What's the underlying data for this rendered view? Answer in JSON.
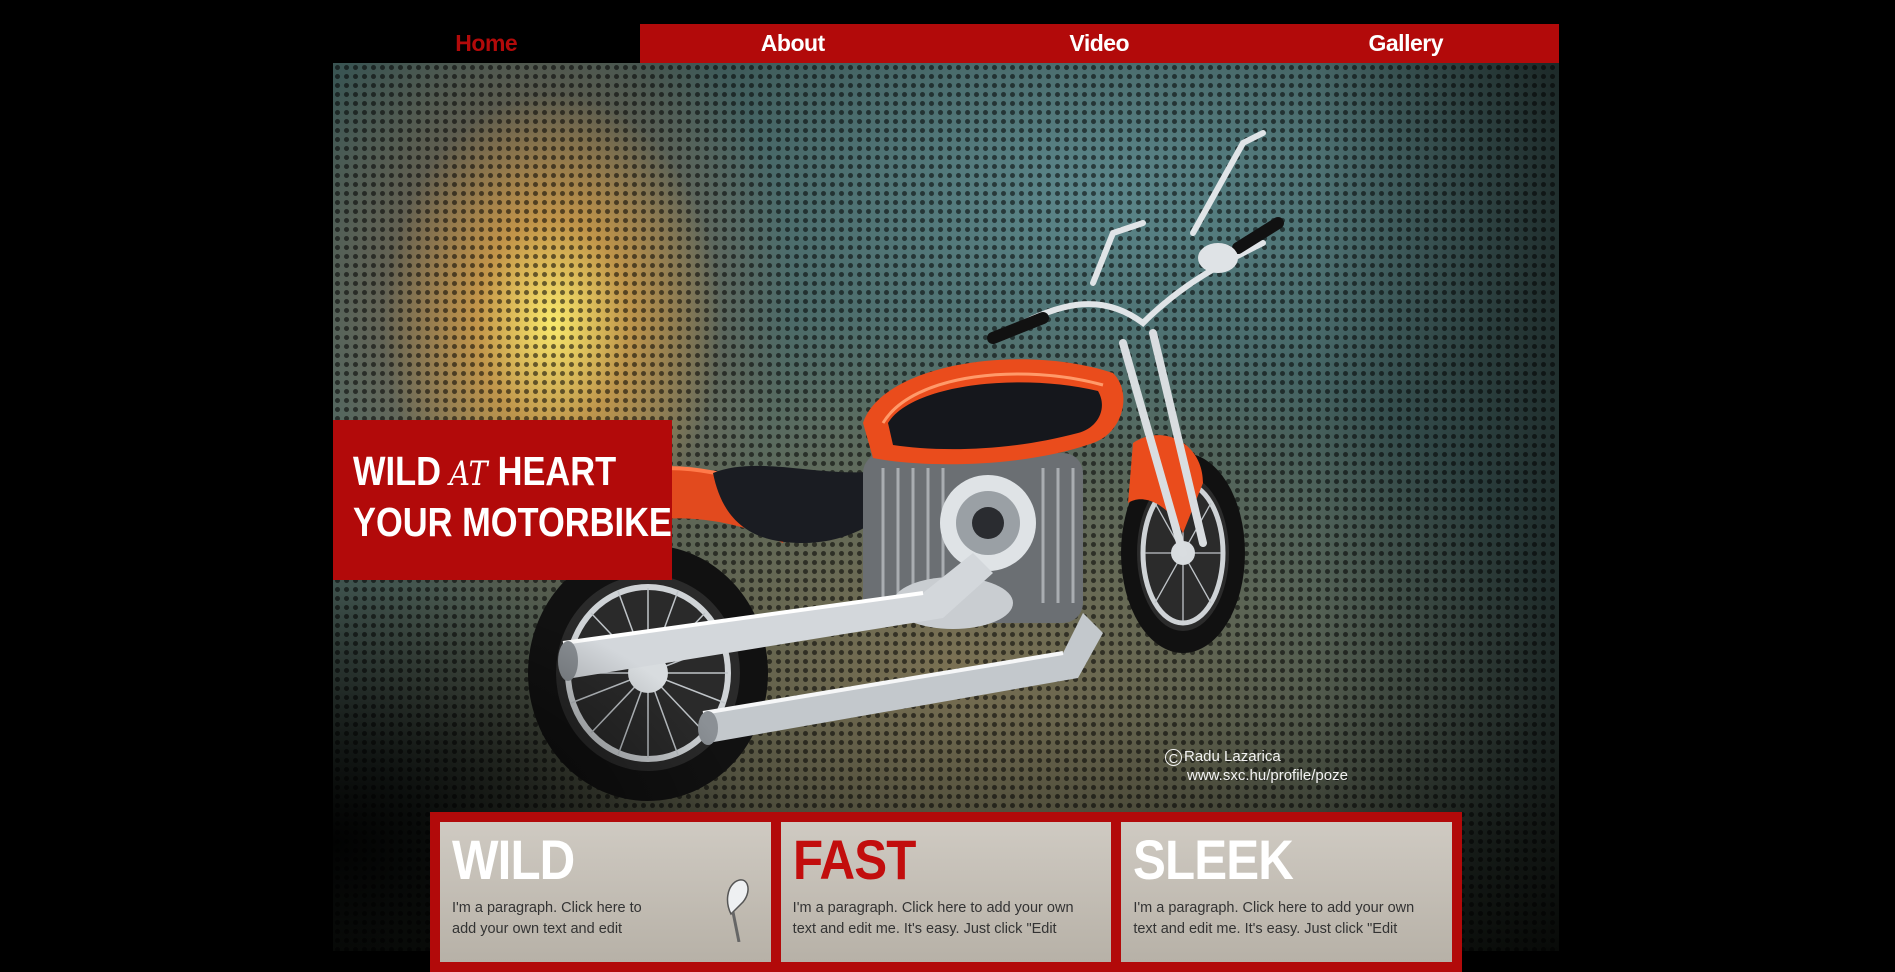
{
  "nav": {
    "items": [
      {
        "label": "Home",
        "active": true
      },
      {
        "label": "About",
        "active": false
      },
      {
        "label": "Video",
        "active": false
      },
      {
        "label": "Gallery",
        "active": false
      }
    ]
  },
  "hero": {
    "headline_line1_a": "WILD",
    "headline_line1_at": "AT",
    "headline_line1_b": "HEART",
    "headline_line2": "YOUR MOTORBIKE",
    "credit_symbol": "C",
    "credit_name": "Radu Lazarica",
    "credit_url": "www.sxc.hu/profile/poze"
  },
  "features": [
    {
      "title": "WILD",
      "text": "I'm a paragraph. Click here to add your own text and edit"
    },
    {
      "title": "FAST",
      "text": "I'm a paragraph. Click here to add your own text and edit me. It's easy. Just click \"Edit"
    },
    {
      "title": "SLEEK",
      "text": "I'm a paragraph. Click here to add your own text and edit me. It's easy. Just click \"Edit"
    }
  ],
  "colors": {
    "brand_red": "#b20a0a",
    "title_red": "#c20d0d",
    "background": "#000000",
    "card": "#cfcac2"
  }
}
